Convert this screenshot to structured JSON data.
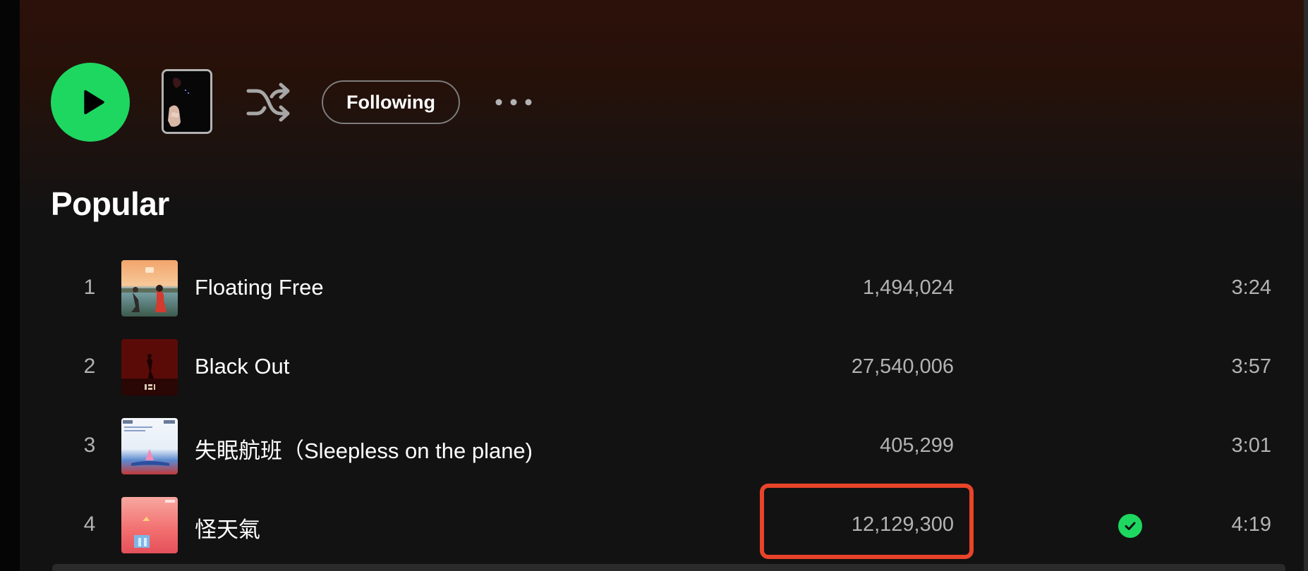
{
  "action_bar": {
    "play_icon": "play-icon",
    "shuffle_icon": "shuffle-icon",
    "following_label": "Following",
    "more_icon": "more-options-icon"
  },
  "section": {
    "title": "Popular"
  },
  "tracks": [
    {
      "number": "1",
      "title": "Floating Free",
      "plays": "1,494,024",
      "duration": "3:24",
      "saved": false
    },
    {
      "number": "2",
      "title": "Black Out",
      "plays": "27,540,006",
      "duration": "3:57",
      "saved": false
    },
    {
      "number": "3",
      "title": "失眠航班（Sleepless on the plane)",
      "plays": "405,299",
      "duration": "3:01",
      "saved": false
    },
    {
      "number": "4",
      "title": "怪天氣",
      "plays": "12,129,300",
      "duration": "4:19",
      "saved": true
    }
  ],
  "colors": {
    "accent": "#1ed760",
    "highlight": "#e8442a",
    "background": "#121212",
    "muted_text": "#b3b3b3"
  }
}
